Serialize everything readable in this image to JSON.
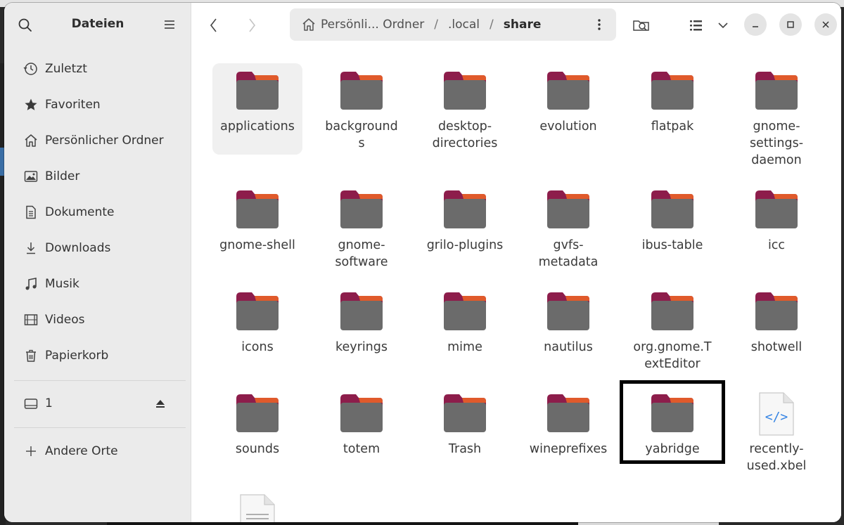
{
  "sidebar": {
    "title": "Dateien",
    "items": [
      {
        "label": "Zuletzt",
        "icon": "recent-icon"
      },
      {
        "label": "Favoriten",
        "icon": "star-icon"
      },
      {
        "label": "Persönlicher Ordner",
        "icon": "home-icon"
      },
      {
        "label": "Bilder",
        "icon": "pictures-icon"
      },
      {
        "label": "Dokumente",
        "icon": "document-icon"
      },
      {
        "label": "Downloads",
        "icon": "download-icon"
      },
      {
        "label": "Musik",
        "icon": "music-icon"
      },
      {
        "label": "Videos",
        "icon": "video-icon"
      },
      {
        "label": "Papierkorb",
        "icon": "trash-icon"
      }
    ],
    "drive": {
      "label": "1",
      "icon": "drive-icon"
    },
    "other_locations": {
      "label": "Andere Orte",
      "icon": "plus-icon"
    }
  },
  "pathbar": {
    "crumbs": [
      "Persönli... Ordner",
      ".local",
      "share"
    ],
    "separator": "/"
  },
  "files": [
    {
      "name": "applications",
      "type": "folder"
    },
    {
      "name": "background\ns",
      "type": "folder"
    },
    {
      "name": "desktop-\ndirectories",
      "type": "folder"
    },
    {
      "name": "evolution",
      "type": "folder"
    },
    {
      "name": "flatpak",
      "type": "folder"
    },
    {
      "name": "gnome-\nsettings-\ndaemon",
      "type": "folder"
    },
    {
      "name": "gnome-shell",
      "type": "folder"
    },
    {
      "name": "gnome-\nsoftware",
      "type": "folder"
    },
    {
      "name": "grilo-plugins",
      "type": "folder"
    },
    {
      "name": "gvfs-\nmetadata",
      "type": "folder"
    },
    {
      "name": "ibus-table",
      "type": "folder"
    },
    {
      "name": "icc",
      "type": "folder"
    },
    {
      "name": "icons",
      "type": "folder"
    },
    {
      "name": "keyrings",
      "type": "folder"
    },
    {
      "name": "mime",
      "type": "folder"
    },
    {
      "name": "nautilus",
      "type": "folder"
    },
    {
      "name": "org.gnome.T\nextEditor",
      "type": "folder"
    },
    {
      "name": "shotwell",
      "type": "folder"
    },
    {
      "name": "sounds",
      "type": "folder"
    },
    {
      "name": "totem",
      "type": "folder"
    },
    {
      "name": "Trash",
      "type": "folder"
    },
    {
      "name": "wineprefixes",
      "type": "folder"
    },
    {
      "name": "yabridge",
      "type": "folder"
    },
    {
      "name": "recently-\nused.xbel",
      "type": "xml"
    },
    {
      "name": "",
      "type": "text"
    }
  ],
  "colors": {
    "folder_body": "#6b6b6b",
    "folder_tab_top": "#8d1d4b",
    "folder_tab_accent": "#e05a2b",
    "sidebar_bg": "#ebebeb",
    "xml_accent": "#3584e4"
  }
}
